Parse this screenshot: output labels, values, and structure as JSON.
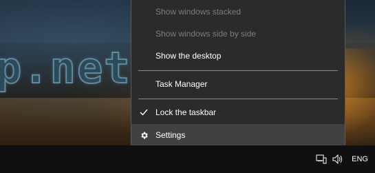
{
  "wallpaper": {
    "watermark_text": "p.net"
  },
  "menu": {
    "items": [
      {
        "label": "Show windows stacked",
        "enabled": false
      },
      {
        "label": "Show windows side by side",
        "enabled": false
      },
      {
        "label": "Show the desktop",
        "enabled": true
      },
      {
        "label": "Task Manager",
        "enabled": true
      },
      {
        "label": "Lock the taskbar",
        "enabled": true,
        "checked": true,
        "icon": "checkmark-icon"
      },
      {
        "label": "Settings",
        "enabled": true,
        "icon": "gear-icon",
        "highlighted": true
      }
    ]
  },
  "taskbar": {
    "tray": {
      "network_icon": "network-icon",
      "volume_icon": "speaker-icon",
      "language": "ENG"
    }
  },
  "colors": {
    "menu_bg": "#2b2b2b",
    "menu_border": "#5a5a5a",
    "menu_hover": "#414141",
    "text": "#ffffff",
    "text_disabled": "#7d7d7d",
    "taskbar": "#101010"
  }
}
